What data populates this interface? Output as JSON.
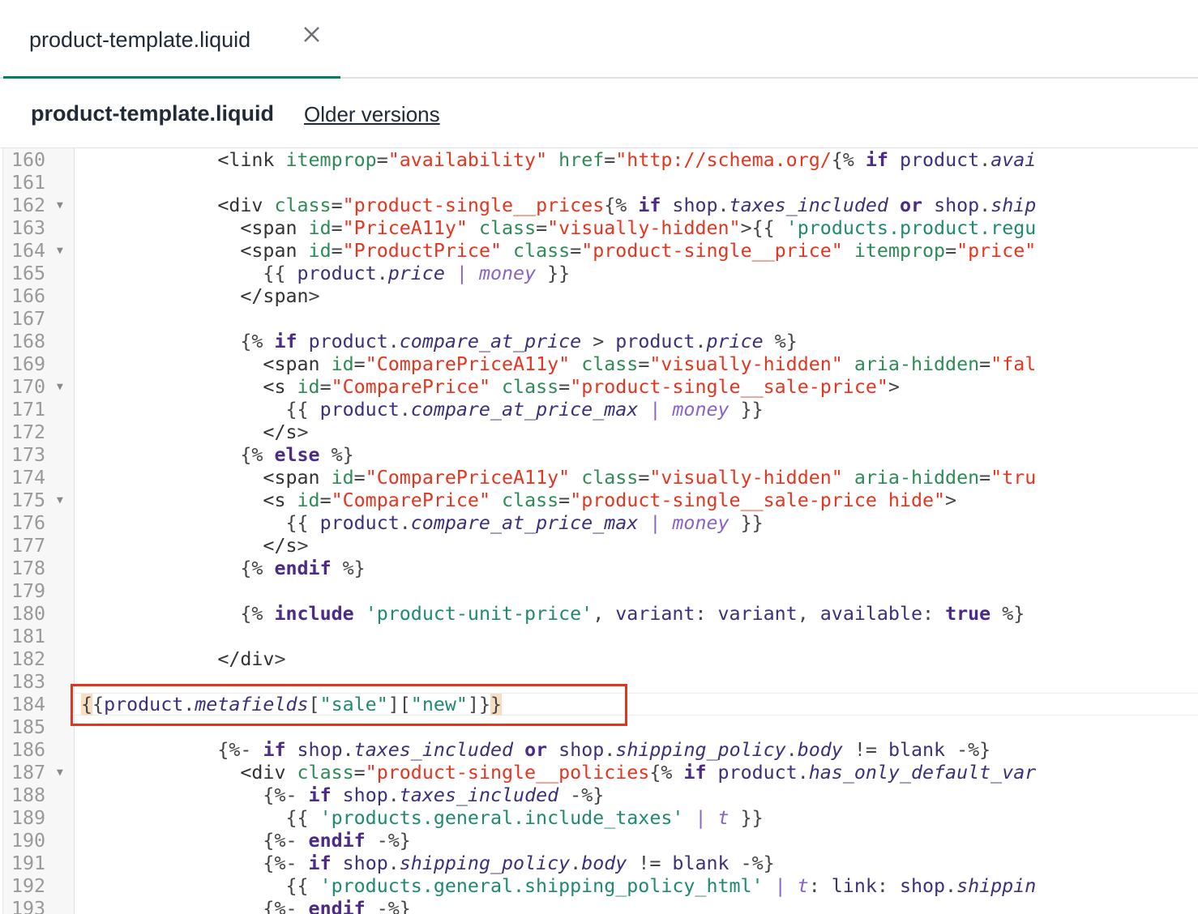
{
  "tab": {
    "title": "product-template.liquid",
    "close_icon": "close-icon"
  },
  "header": {
    "title": "product-template.liquid",
    "older_versions": "Older versions"
  },
  "editor": {
    "lines": [
      {
        "n": "160",
        "fold": "",
        "code": "            <link itemprop=\"availability\" href=\"http://schema.org/{% if product.avai"
      },
      {
        "n": "161",
        "fold": "",
        "code": ""
      },
      {
        "n": "162",
        "fold": "▼",
        "code": "            <div class=\"product-single__prices{% if shop.taxes_included or shop.ship"
      },
      {
        "n": "163",
        "fold": "",
        "code": "              <span id=\"PriceA11y\" class=\"visually-hidden\">{{ 'products.product.regu"
      },
      {
        "n": "164",
        "fold": "▼",
        "code": "              <span id=\"ProductPrice\" class=\"product-single__price\" itemprop=\"price\""
      },
      {
        "n": "165",
        "fold": "",
        "code": "                {{ product.price | money }}"
      },
      {
        "n": "166",
        "fold": "",
        "code": "              </span>"
      },
      {
        "n": "167",
        "fold": "",
        "code": ""
      },
      {
        "n": "168",
        "fold": "",
        "code": "              {% if product.compare_at_price > product.price %}"
      },
      {
        "n": "169",
        "fold": "",
        "code": "                <span id=\"ComparePriceA11y\" class=\"visually-hidden\" aria-hidden=\"fal"
      },
      {
        "n": "170",
        "fold": "▼",
        "code": "                <s id=\"ComparePrice\" class=\"product-single__sale-price\">"
      },
      {
        "n": "171",
        "fold": "",
        "code": "                  {{ product.compare_at_price_max | money }}"
      },
      {
        "n": "172",
        "fold": "",
        "code": "                </s>"
      },
      {
        "n": "173",
        "fold": "",
        "code": "              {% else %}"
      },
      {
        "n": "174",
        "fold": "",
        "code": "                <span id=\"ComparePriceA11y\" class=\"visually-hidden\" aria-hidden=\"tru"
      },
      {
        "n": "175",
        "fold": "▼",
        "code": "                <s id=\"ComparePrice\" class=\"product-single__sale-price hide\">"
      },
      {
        "n": "176",
        "fold": "",
        "code": "                  {{ product.compare_at_price_max | money }}"
      },
      {
        "n": "177",
        "fold": "",
        "code": "                </s>"
      },
      {
        "n": "178",
        "fold": "",
        "code": "              {% endif %}"
      },
      {
        "n": "179",
        "fold": "",
        "code": ""
      },
      {
        "n": "180",
        "fold": "",
        "code": "              {% include 'product-unit-price', variant: variant, available: true %}"
      },
      {
        "n": "181",
        "fold": "",
        "code": ""
      },
      {
        "n": "182",
        "fold": "",
        "code": "            </div>"
      },
      {
        "n": "183",
        "fold": "",
        "code": ""
      },
      {
        "n": "184",
        "fold": "",
        "code": "{{product.metafields[\"sale\"][\"new\"]}}"
      },
      {
        "n": "185",
        "fold": "",
        "code": ""
      },
      {
        "n": "186",
        "fold": "",
        "code": "            {%- if shop.taxes_included or shop.shipping_policy.body != blank -%}"
      },
      {
        "n": "187",
        "fold": "▼",
        "code": "              <div class=\"product-single__policies{% if product.has_only_default_var"
      },
      {
        "n": "188",
        "fold": "",
        "code": "                {%- if shop.taxes_included -%}"
      },
      {
        "n": "189",
        "fold": "",
        "code": "                  {{ 'products.general.include_taxes' | t }}"
      },
      {
        "n": "190",
        "fold": "",
        "code": "                {%- endif -%}"
      },
      {
        "n": "191",
        "fold": "",
        "code": "                {%- if shop.shipping_policy.body != blank -%}"
      },
      {
        "n": "192",
        "fold": "",
        "code": "                  {{ 'products.general.shipping_policy_html' | t: link: shop.shippin"
      },
      {
        "n": "193",
        "fold": "",
        "code": "                {%- endif -%}"
      }
    ]
  }
}
